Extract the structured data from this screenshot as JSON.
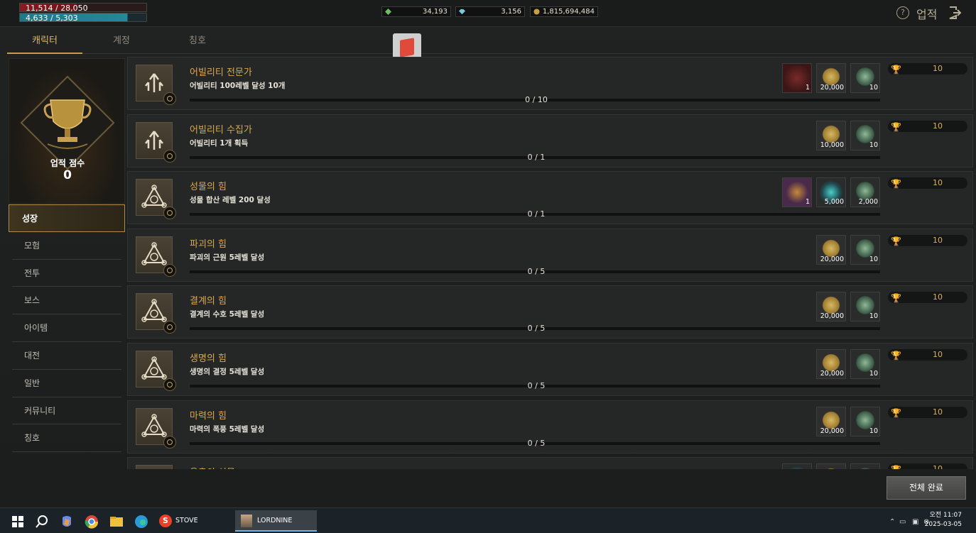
{
  "hud": {
    "hp": "11,514 / 28,050",
    "mp": "4,633 / 5,303",
    "currencies": [
      {
        "icon": "green-gem-icon",
        "value": "34,193"
      },
      {
        "icon": "blue-diamond-icon",
        "value": "3,156"
      },
      {
        "icon": "gold-coin-icon",
        "value": "1,815,694,484"
      }
    ],
    "title": "업적",
    "help_label": "?"
  },
  "tabs": [
    "캐릭터",
    "계정",
    "칭호"
  ],
  "score": {
    "label": "업적 점수",
    "value": "0"
  },
  "nav": [
    "성장",
    "모험",
    "전투",
    "보스",
    "아이템",
    "대전",
    "일반",
    "커뮤니티",
    "칭호"
  ],
  "achievements": [
    {
      "title": "어빌리티 전문가",
      "desc": "어빌리티 100레벨 달성 10개",
      "progress": "0 / 10",
      "progress_fraction": 0,
      "icon": "arrows-up-icon",
      "rewards": [
        {
          "type": "red",
          "count": "1"
        },
        {
          "type": "gold",
          "count": "20,000"
        },
        {
          "type": "emblem",
          "count": "10"
        }
      ],
      "points": "10"
    },
    {
      "title": "어빌리티 수집가",
      "desc": "어빌리티 1개 획득",
      "progress": "0 / 1",
      "progress_fraction": 0,
      "icon": "arrows-up-icon",
      "rewards": [
        {
          "type": "gold",
          "count": "10,000"
        },
        {
          "type": "emblem",
          "count": "10"
        }
      ],
      "points": "10"
    },
    {
      "title": "성물의 힘",
      "desc": "성물 합산 레벨 200 달성",
      "progress": "0 / 1",
      "progress_fraction": 0,
      "icon": "triangle-rune-icon",
      "rewards": [
        {
          "type": "purple",
          "count": "1"
        },
        {
          "type": "crystal",
          "count": "5,000"
        },
        {
          "type": "emblem",
          "count": "2,000"
        }
      ],
      "points": "10"
    },
    {
      "title": "파괴의 힘",
      "desc": "파괴의 근원 5레벨 달성",
      "progress": "0 / 5",
      "progress_fraction": 0,
      "icon": "triangle-rune-icon",
      "rewards": [
        {
          "type": "gold",
          "count": "20,000"
        },
        {
          "type": "emblem",
          "count": "10"
        }
      ],
      "points": "10"
    },
    {
      "title": "결계의 힘",
      "desc": "결계의 수호 5레벨 달성",
      "progress": "0 / 5",
      "progress_fraction": 0,
      "icon": "triangle-rune-icon",
      "rewards": [
        {
          "type": "gold",
          "count": "20,000"
        },
        {
          "type": "emblem",
          "count": "10"
        }
      ],
      "points": "10"
    },
    {
      "title": "생명의 힘",
      "desc": "생명의 결정 5레벨 달성",
      "progress": "0 / 5",
      "progress_fraction": 0,
      "icon": "triangle-rune-icon",
      "rewards": [
        {
          "type": "gold",
          "count": "20,000"
        },
        {
          "type": "emblem",
          "count": "10"
        }
      ],
      "points": "10"
    },
    {
      "title": "마력의 힘",
      "desc": "마력의 폭풍 5레벨 달성",
      "progress": "0 / 5",
      "progress_fraction": 0,
      "icon": "triangle-rune-icon",
      "rewards": [
        {
          "type": "gold",
          "count": "20,000"
        },
        {
          "type": "emblem",
          "count": "10"
        }
      ],
      "points": "10"
    },
    {
      "title": "응축의 성물",
      "desc": "",
      "progress": "",
      "progress_fraction": 0,
      "icon": "triangle-rune-icon",
      "rewards": [
        {
          "type": "crystal",
          "count": ""
        },
        {
          "type": "gold",
          "count": ""
        },
        {
          "type": "emblem",
          "count": ""
        }
      ],
      "points": "10"
    }
  ],
  "complete_all": "전체 완료",
  "taskbar": {
    "apps": [
      "STOVE",
      "LORDNINE"
    ],
    "time": "오전 11:07",
    "date": "2025-03-05"
  }
}
